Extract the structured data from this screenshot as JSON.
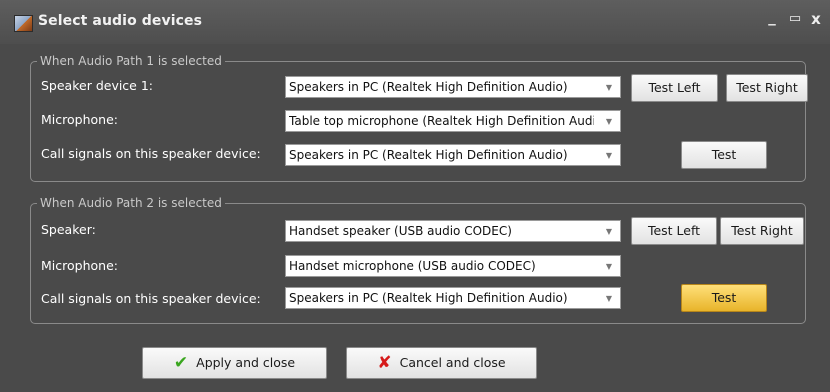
{
  "window": {
    "title": "Select audio devices",
    "minimize": "_",
    "maximize": "▭",
    "close": "x"
  },
  "path1": {
    "legend": "When Audio Path 1 is selected",
    "speaker_label": "Speaker device 1:",
    "speaker_value": "Speakers in PC (Realtek High Definition Audio)",
    "mic_label": "Microphone:",
    "mic_value": "Table top microphone (Realtek High Definition Audio)",
    "call_label": "Call signals on this speaker device:",
    "call_value": "Speakers in PC (Realtek High Definition Audio)",
    "test_left": "Test Left",
    "test_right": "Test Right",
    "test": "Test"
  },
  "path2": {
    "legend": "When Audio Path 2 is selected",
    "speaker_label": "Speaker:",
    "speaker_value": "Handset speaker (USB audio CODEC)",
    "mic_label": "Microphone:",
    "mic_value": "Handset microphone (USB audio CODEC)",
    "call_label": "Call signals on this speaker device:",
    "call_value": "Speakers in PC (Realtek High Definition Audio)",
    "test_left": "Test Left",
    "test_right": "Test Right",
    "test": "Test"
  },
  "footer": {
    "apply": "Apply and close",
    "cancel": "Cancel and close"
  },
  "icons": {
    "dropdown": "▼",
    "apply": "✔",
    "cancel": "✘"
  },
  "colors": {
    "window_bg": "#4a4a4a",
    "active_button": "#f0c44a"
  }
}
